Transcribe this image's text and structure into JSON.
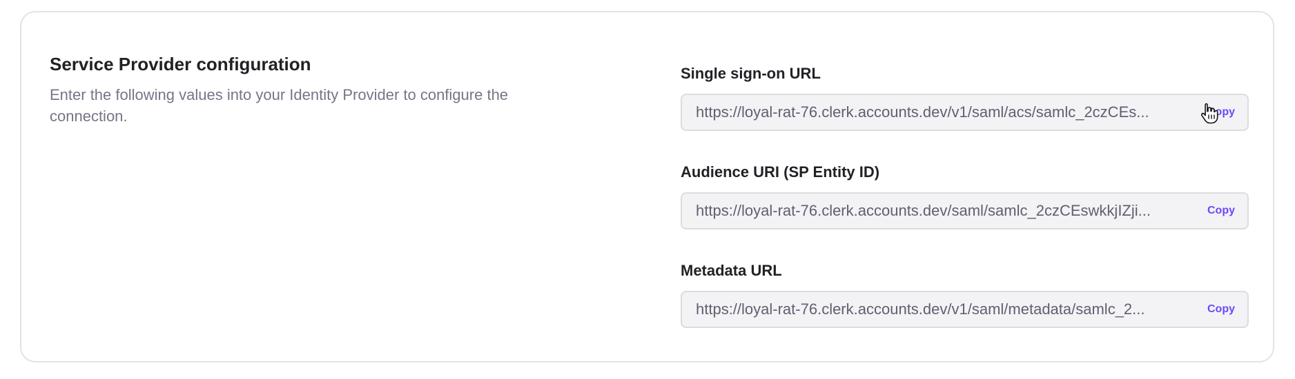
{
  "section": {
    "title": "Service Provider configuration",
    "description": "Enter the following values into your Identity Provider to configure the connection."
  },
  "fields": [
    {
      "label": "Single sign-on URL",
      "value": "https://loyal-rat-76.clerk.accounts.dev/v1/saml/acs/samlc_2czCEs...",
      "copy_label": "Copy"
    },
    {
      "label": "Audience URI (SP Entity ID)",
      "value": "https://loyal-rat-76.clerk.accounts.dev/saml/samlc_2czCEswkkjIZji...",
      "copy_label": "Copy"
    },
    {
      "label": "Metadata URL",
      "value": "https://loyal-rat-76.clerk.accounts.dev/v1/saml/metadata/samlc_2...",
      "copy_label": "Copy"
    }
  ],
  "colors": {
    "accent": "#6c47ff",
    "title": "#212126",
    "muted": "#747686",
    "input_bg": "#f3f3f5",
    "border": "#dcdce0"
  },
  "icons": {
    "cursor": "hand-pointer-icon"
  }
}
